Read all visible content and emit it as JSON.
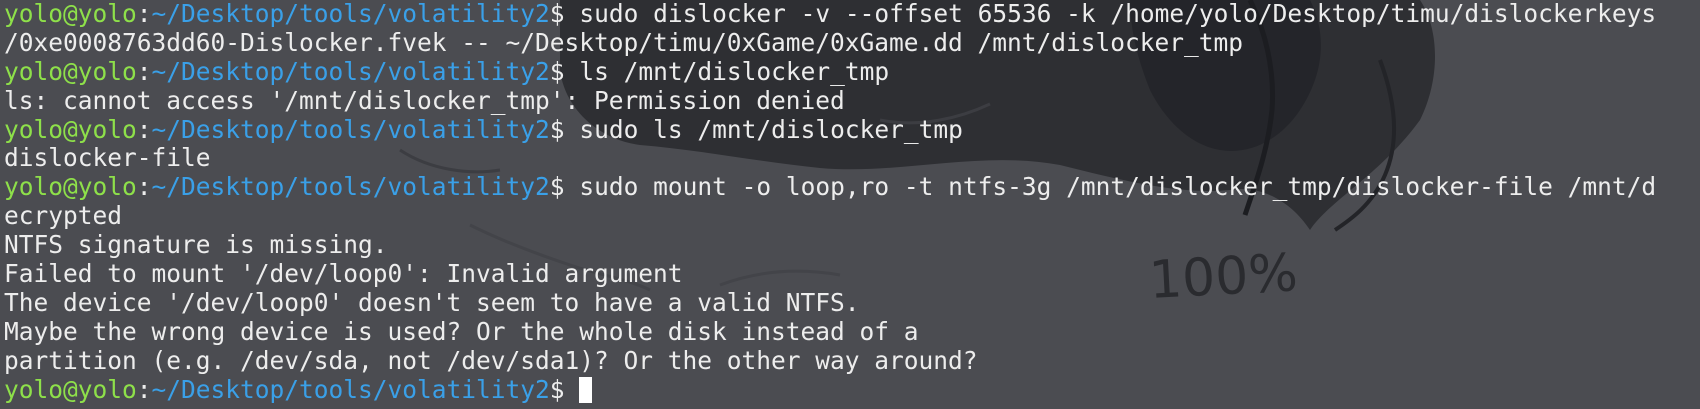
{
  "colors": {
    "background": "#4b4c51",
    "prompt_user": "#8ee04a",
    "prompt_path": "#3aa0e8",
    "text": "#ededed",
    "cursor": "#ffffff"
  },
  "wallpaper": {
    "sketch_text": "100%"
  },
  "terminal": {
    "prompt": {
      "user": "yolo@yolo",
      "separator": ":",
      "path": "~/Desktop/tools/volatility2",
      "symbol": "$"
    },
    "lines": [
      {
        "type": "prompt",
        "command": " sudo dislocker -v --offset 65536 -k /home/yolo/Desktop/timu/dislockerkeys"
      },
      {
        "type": "output",
        "text": "/0xe0008763dd60-Dislocker.fvek -- ~/Desktop/timu/0xGame/0xGame.dd /mnt/dislocker_tmp"
      },
      {
        "type": "prompt",
        "command": " ls /mnt/dislocker_tmp"
      },
      {
        "type": "output",
        "text": "ls: cannot access '/mnt/dislocker_tmp': Permission denied"
      },
      {
        "type": "prompt",
        "command": " sudo ls /mnt/dislocker_tmp"
      },
      {
        "type": "output",
        "text": "dislocker-file"
      },
      {
        "type": "prompt",
        "command": " sudo mount -o loop,ro -t ntfs-3g /mnt/dislocker_tmp/dislocker-file /mnt/d"
      },
      {
        "type": "output",
        "text": "ecrypted"
      },
      {
        "type": "output",
        "text": "NTFS signature is missing."
      },
      {
        "type": "output",
        "text": "Failed to mount '/dev/loop0': Invalid argument"
      },
      {
        "type": "output",
        "text": "The device '/dev/loop0' doesn't seem to have a valid NTFS."
      },
      {
        "type": "output",
        "text": "Maybe the wrong device is used? Or the whole disk instead of a"
      },
      {
        "type": "output",
        "text": "partition (e.g. /dev/sda, not /dev/sda1)? Or the other way around?"
      },
      {
        "type": "prompt",
        "command": " "
      }
    ]
  }
}
